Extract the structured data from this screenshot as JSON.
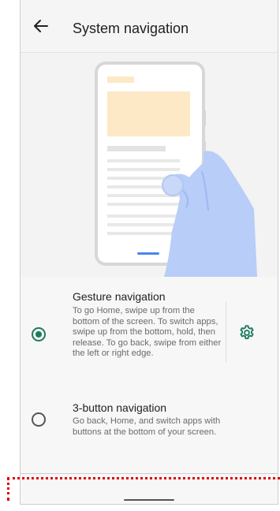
{
  "header": {
    "title": "System navigation",
    "back_icon": "arrow-left-icon"
  },
  "colors": {
    "accent": "#1e7b5f",
    "illustration_hand": "#b8cdf7",
    "illustration_card": "#fde9c6"
  },
  "options": [
    {
      "title": "Gesture navigation",
      "description": "To go Home, swipe up from the bottom of the screen. To switch apps, swipe up from the bottom, hold, then release. To go back, swipe from either the left or right edge.",
      "selected": true,
      "settings_icon": "gear-icon"
    },
    {
      "title": "3-button navigation",
      "description": "Go back, Home, and switch apps with buttons at the bottom of your screen.",
      "selected": false
    }
  ]
}
